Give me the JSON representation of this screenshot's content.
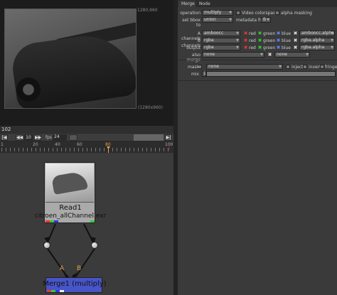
{
  "viewer": {
    "top_right_coord": "1280,960",
    "bottom_right_coord": "(1280x960)",
    "current_frame": "102"
  },
  "transport": {
    "start": "|◀",
    "back": "◀◀",
    "step": "10",
    "forward": "▶▶",
    "fps_label": "fps",
    "fps_value": "24",
    "end": "▶|"
  },
  "timeline": {
    "ticks": [
      "1",
      "20",
      "40",
      "60",
      "80",
      "100"
    ],
    "playhead_frame": "80",
    "end_frame": "100",
    "frame_range": [
      1,
      100
    ],
    "current_frame_value": 80
  },
  "nodegraph": {
    "read_node": {
      "name": "Read1",
      "file": "citroen_allChannel.exr"
    },
    "merge_node": {
      "name": "Merge1 (multiply)",
      "input_a": "A",
      "input_b": "B"
    }
  },
  "properties": {
    "tabs": [
      "Merge",
      "Node"
    ],
    "operation": {
      "label": "operation",
      "value": "multiply"
    },
    "video_colorspace": "Video colorspace",
    "alpha_masking": "alpha masking",
    "set_bbox": {
      "label": "set bbox to",
      "value": "union"
    },
    "metadata_from": {
      "label": "metadata from",
      "value": "B"
    },
    "a_channels": {
      "label": "A channels",
      "value": "amboocc",
      "alpha": "amboocc.alpha"
    },
    "b_channels": {
      "label": "B channels",
      "value": "rgba",
      "alpha": "rgba.alpha"
    },
    "output": {
      "label": "output",
      "value": "rgba",
      "alpha": "rgba.alpha"
    },
    "also_merge": {
      "label": "also merge",
      "value": "none",
      "value2": "none"
    },
    "channel_names": {
      "red": "red",
      "green": "green",
      "blue": "blue"
    },
    "mask": {
      "label": "mask",
      "value": "none",
      "inject": "inject",
      "invert": "invert",
      "fringe": "fringe"
    },
    "mix": {
      "label": "mix",
      "value": "1"
    }
  },
  "colors": {
    "merge_node": "#4855c8",
    "pipe_label": "#e9a050",
    "red": "#e33",
    "green": "#3c3",
    "blue": "#58f"
  }
}
